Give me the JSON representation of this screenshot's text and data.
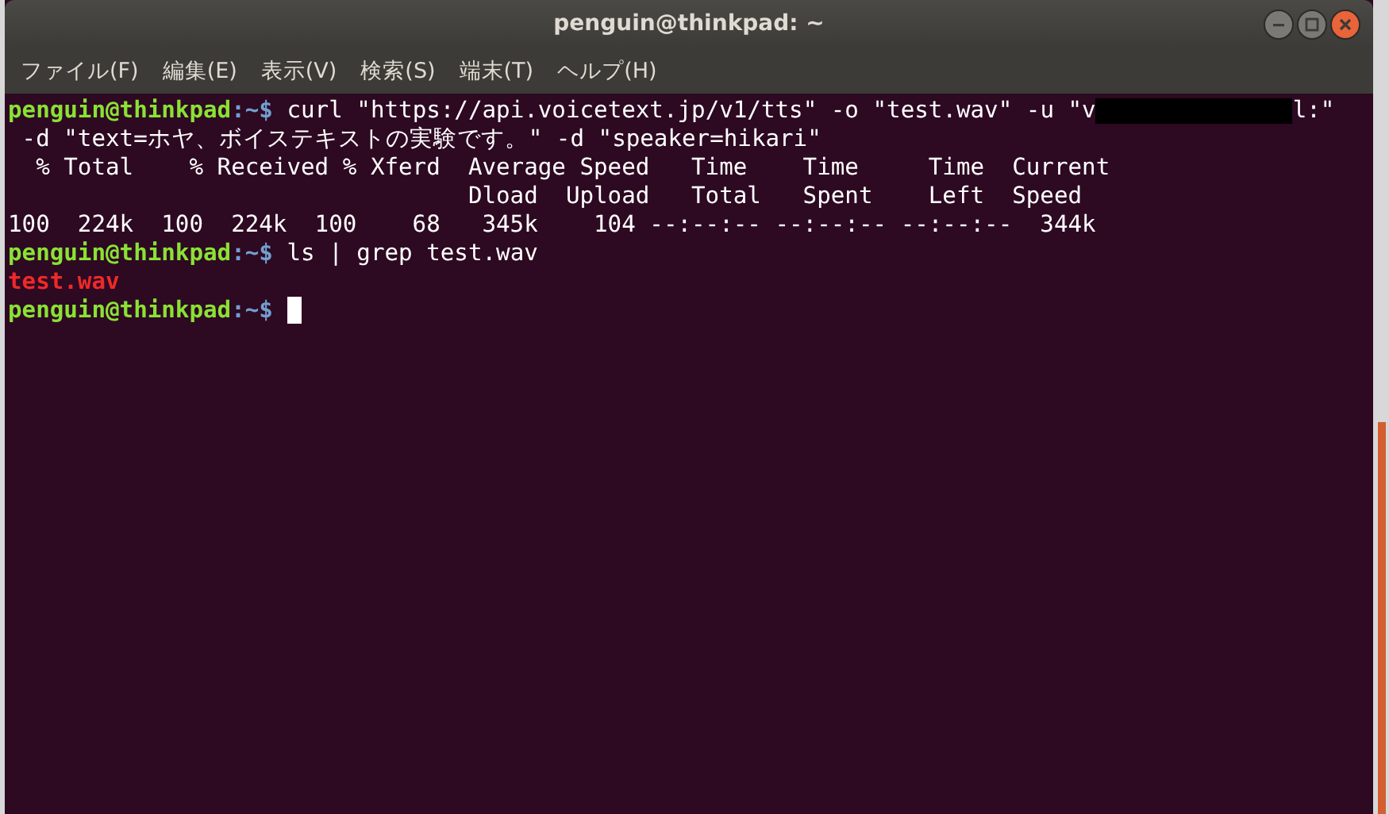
{
  "window": {
    "title": "penguin@thinkpad: ~"
  },
  "menu": [
    "ファイル(F)",
    "編集(E)",
    "表示(V)",
    "検索(S)",
    "端末(T)",
    "ヘルプ(H)"
  ],
  "terminal": {
    "lines": [
      {
        "segments": [
          {
            "kind": "user",
            "text": "penguin@thinkpad"
          },
          {
            "kind": "path",
            "text": ":~$"
          },
          {
            "kind": "text",
            "text": " curl \"https://api.voicetext.jp/v1/tts\" -o \"test.wav\" -u \"v"
          },
          {
            "kind": "redacted"
          },
          {
            "kind": "text",
            "text": "l:\""
          }
        ]
      },
      {
        "segments": [
          {
            "kind": "text",
            "text": " -d \"text=ホヤ、ボイステキストの実験です。\" -d \"speaker=hikari\""
          }
        ]
      },
      {
        "segments": [
          {
            "kind": "text",
            "text": "  % Total    % Received % Xferd  Average Speed   Time    Time     Time  Current"
          }
        ]
      },
      {
        "segments": [
          {
            "kind": "text",
            "text": "                                 Dload  Upload   Total   Spent    Left  Speed"
          }
        ]
      },
      {
        "segments": [
          {
            "kind": "text",
            "text": "100  224k  100  224k  100    68   345k    104 --:--:-- --:--:-- --:--:--  344k"
          }
        ]
      },
      {
        "segments": [
          {
            "kind": "user",
            "text": "penguin@thinkpad"
          },
          {
            "kind": "path",
            "text": ":~$"
          },
          {
            "kind": "text",
            "text": " ls | grep test.wav"
          }
        ]
      },
      {
        "segments": [
          {
            "kind": "file",
            "text": "test.wav"
          }
        ]
      },
      {
        "segments": [
          {
            "kind": "user",
            "text": "penguin@thinkpad"
          },
          {
            "kind": "path",
            "text": ":~$"
          },
          {
            "kind": "cursor"
          }
        ]
      }
    ]
  }
}
